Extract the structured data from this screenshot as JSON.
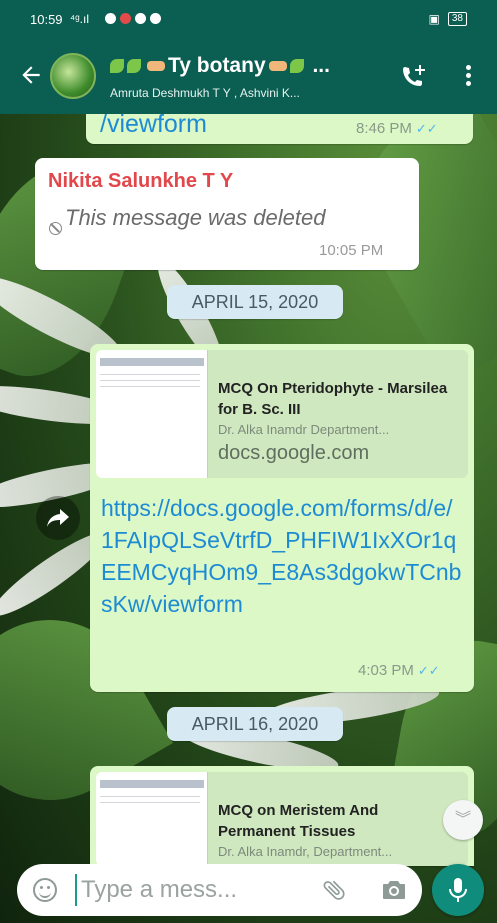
{
  "status_bar": {
    "time": "10:59",
    "signal": "⁴ᵍ.ıl",
    "battery": "38"
  },
  "header": {
    "title": "Ty botany",
    "title_suffix": "...",
    "subtitle": "Amruta Deshmukh T Y , Ashvini K..."
  },
  "messages": {
    "top_fragment": {
      "text": "/viewform",
      "time": "8:46 PM"
    },
    "deleted": {
      "sender": "Nikita Salunkhe T Y",
      "text": "This message was deleted",
      "time": "10:05 PM"
    },
    "date_1": "APRIL 15, 2020",
    "link_1": {
      "preview_title": "MCQ On Pteridophyte - Marsilea for B. Sc. III",
      "preview_desc": "Dr. Alka Inamdr Department...",
      "preview_domain": "docs.google.com",
      "url": "https://docs.google.com/forms/d/e/1FAIpQLSeVtrfD_PHFIW1IxXOr1qEEMCyqHOm9_E8As3dgokwTCnbsKw/viewform",
      "time": "4:03 PM"
    },
    "date_2": "APRIL 16, 2020",
    "link_2": {
      "preview_title": "MCQ on Meristem And Permanent Tissues",
      "preview_desc": "Dr. Alka Inamdr, Department..."
    }
  },
  "input": {
    "placeholder": "Type a mess..."
  },
  "icons": {
    "back": "arrow-back-icon",
    "call_add": "call-add-icon",
    "more": "more-vert-icon",
    "forward": "forward-icon",
    "scroll_down": "double-chevron-down-icon",
    "emoji": "emoji-icon",
    "attach": "paperclip-icon",
    "camera": "camera-icon",
    "mic": "mic-icon"
  },
  "colors": {
    "header_bg": "#0b5e52",
    "outgoing_bubble": "#dcf8c6",
    "incoming_bubble": "#ffffff",
    "link": "#1d8bd4",
    "sender_name": "#e2474b",
    "date_chip": "#d7e9f2",
    "accent": "#108c7c",
    "read_ticks": "#4fb6ec"
  }
}
